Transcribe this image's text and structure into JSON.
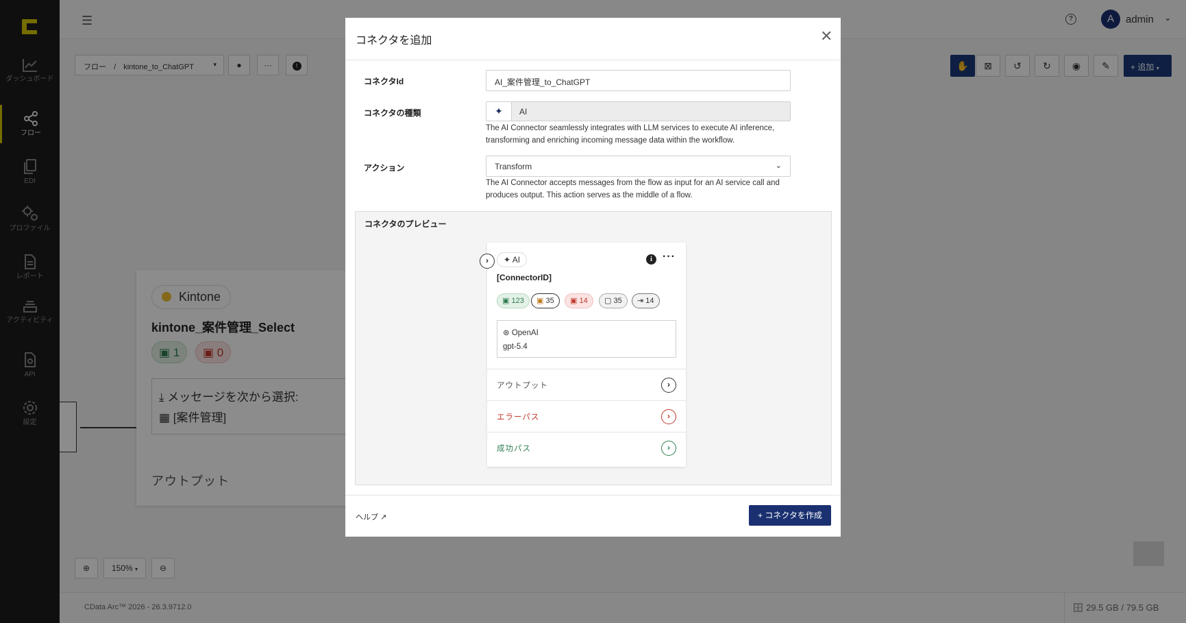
{
  "sidebar": {
    "items": [
      {
        "label": "ダッシュボード",
        "icon": "chart-line-icon"
      },
      {
        "label": "フロー",
        "icon": "share-nodes-icon"
      },
      {
        "label": "EDI",
        "icon": "documents-icon"
      },
      {
        "label": "プロファイル",
        "icon": "gears-icon"
      },
      {
        "label": "レポート",
        "icon": "report-icon"
      },
      {
        "label": "アクティビティ",
        "icon": "stack-icon"
      },
      {
        "label": "API",
        "icon": "api-file-icon"
      },
      {
        "label": "設定",
        "icon": "settings-gear-icon"
      }
    ]
  },
  "topbar": {
    "user_initial": "A",
    "user_name": "admin"
  },
  "canvas": {
    "breadcrumb_root": "フロー",
    "breadcrumb_sep": "/",
    "breadcrumb_flow": "kintone_to_ChatGPT",
    "add_label": "追加",
    "zoom_level": "150%",
    "node": {
      "pill": "Kintone",
      "title": "kintone_案件管理_Select",
      "ok_count": "1",
      "err_count": "0",
      "message_select": "メッセージを次から選択:",
      "table": "[案件管理]",
      "output": "アウトプット"
    }
  },
  "footer": {
    "version": "CData Arc™ 2026 - 26.3.9712.0",
    "disk": "29.5 GB / 79.5 GB"
  },
  "modal": {
    "title": "コネクタを追加",
    "connector_id_label": "コネクタId",
    "connector_id_value": "AI_案件管理_to_ChatGPT",
    "type_label": "コネクタの種類",
    "type_value": "AI",
    "type_desc": "The AI Connector seamlessly integrates with LLM services to execute AI inference, transforming and enriching incoming message data within the workflow.",
    "action_label": "アクション",
    "action_value": "Transform",
    "action_desc": "The AI Connector accepts messages from the flow as input for an AI service call and produces output. This action serves as the middle of a flow.",
    "preview_label": "コネクタのプレビュー",
    "preview": {
      "pill": "AI",
      "connector_id": "[ConnectorID]",
      "badges": [
        "123",
        "35",
        "14",
        "35",
        "14"
      ],
      "provider": "OpenAI",
      "model": "gpt-5.4",
      "output": "アウトプット",
      "error_path": "エラーパス",
      "success_path": "成功パス"
    },
    "help": "ヘルプ",
    "create_button": "コネクタを作成"
  },
  "colors": {
    "primary": "#1a3070",
    "sidebar_bg": "#1c1c1c",
    "success": "#2e7d4f",
    "error": "#c0392b",
    "accent_logo": "#d6c600"
  }
}
